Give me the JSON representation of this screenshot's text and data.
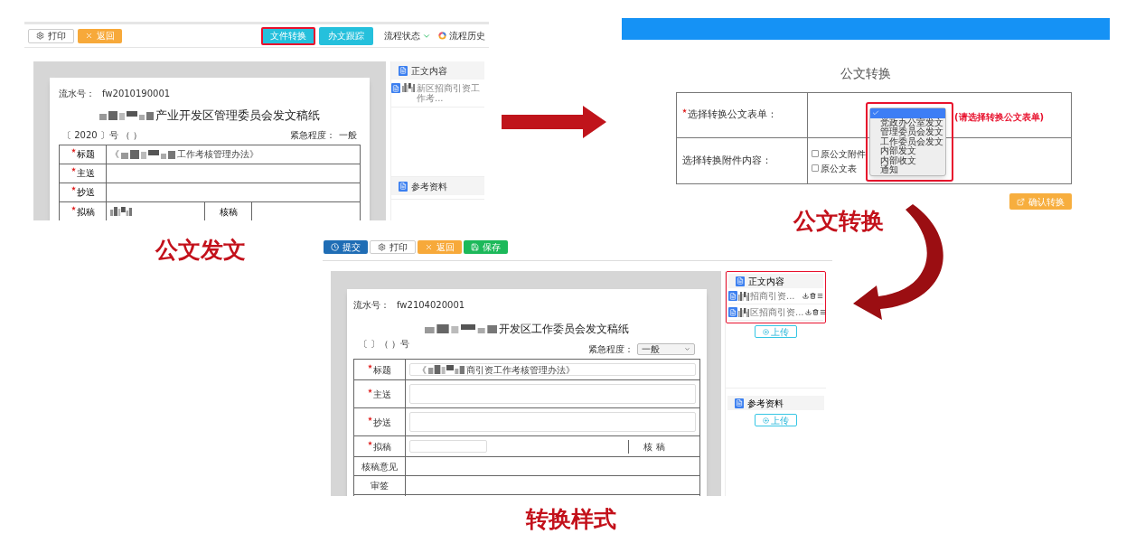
{
  "issue_screen": {
    "toolbar_left": [
      {
        "kind": "print",
        "label": "打印"
      },
      {
        "kind": "back",
        "label": "返回"
      }
    ],
    "toolbar_right": [
      {
        "label": "文件转换",
        "highlighted": true
      },
      {
        "label": "办文跟踪",
        "highlighted": false
      }
    ],
    "status_menu": "流程状态",
    "history_link": "流程历史",
    "serial_label": "流水号：",
    "serial": "fw2010190001",
    "title": "产业开发区管理委员会发文稿纸",
    "title_redacted": true,
    "number": "〔 2020 〕号 （ ）",
    "urgency_label": "紧急程度：",
    "urgency": "一般",
    "rows": [
      {
        "label": "标题",
        "required": true,
        "value_prefix": "《",
        "value": "工作考核管理办法》",
        "redacted": true
      },
      {
        "label": "主送",
        "required": true
      },
      {
        "label": "抄送",
        "required": true
      },
      {
        "label": "拟稿",
        "required": true,
        "redacted": true,
        "extra_label": "核稿"
      }
    ],
    "sidebar": [
      {
        "heading": "正文内容",
        "files": [
          {
            "name": "新区招商引资工作考..."
          }
        ]
      },
      {
        "heading": "参考资料"
      }
    ]
  },
  "convert_screen": {
    "title": "公文转换",
    "form_label": "选择转换公文表单：",
    "form_required": true,
    "options": [
      {
        "selected": true
      },
      {
        "label": "党政办公室发文",
        "selected": false
      },
      {
        "label": "管理委员会发文",
        "selected": false
      },
      {
        "label": "工作委员会发文",
        "selected": false
      },
      {
        "label": "内部发文",
        "selected": false
      },
      {
        "label": "内部收文",
        "selected": false
      },
      {
        "label": "通知",
        "selected": false
      }
    ],
    "hint": "(请选择转换公文表单)",
    "attach_label": "选择转换附件内容：",
    "attachments": [
      {
        "label": "原公文附件",
        "checked": false
      },
      {
        "label": "原公文表",
        "checked": false
      }
    ],
    "confirm_button": "确认转换"
  },
  "style_screen": {
    "toolbar": [
      {
        "kind": "submit",
        "label": "提交"
      },
      {
        "kind": "print",
        "label": "打印"
      },
      {
        "kind": "back",
        "label": "返回"
      },
      {
        "kind": "save",
        "label": "保存"
      }
    ],
    "serial_label": "流水号：",
    "serial": "fw2104020001",
    "title": "开发区工作委员会发文稿纸",
    "title_redacted": true,
    "number": "〔 〕（ ）号",
    "urgency_label": "紧急程度：",
    "urgency": "一般",
    "rows": [
      {
        "kind": "input",
        "label": "标题",
        "required": true,
        "value_prefix": "《",
        "value": "商引资工作考核管理办法》"
      },
      {
        "kind": "textarea",
        "label": "主送",
        "required": true
      },
      {
        "kind": "textarea",
        "label": "抄送",
        "required": true
      },
      {
        "kind": "draft",
        "label": "拟稿",
        "required": true,
        "extra_label": "核 稿"
      },
      {
        "kind": "plain",
        "label": "核稿意见",
        "required": false
      },
      {
        "kind": "plain",
        "label": "审签",
        "required": false
      }
    ],
    "sidebar": [
      {
        "heading": "正文内容",
        "highlighted": true,
        "files": [
          {
            "name": "招商引资..."
          },
          {
            "name": "区招商引资..."
          }
        ],
        "upload": "上传"
      },
      {
        "heading": "参考资料",
        "highlighted": false,
        "upload": "上传"
      }
    ]
  },
  "captions": {
    "issue": "公文发文",
    "convert": "公文转换",
    "style": "转换样式"
  }
}
